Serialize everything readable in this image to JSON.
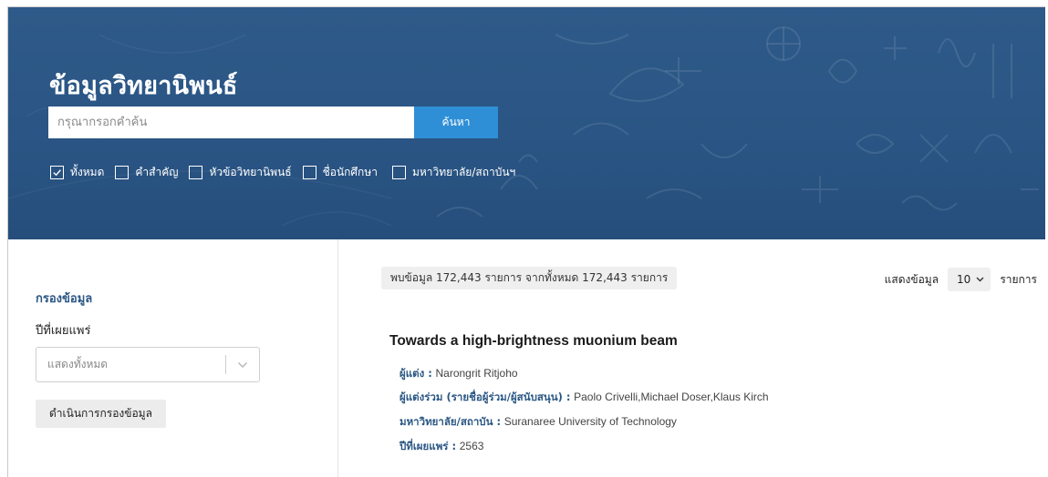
{
  "header": {
    "title": "ข้อมูลวิทยานิพนธ์",
    "search_placeholder": "กรุณากรอกคำค้น",
    "search_button": "ค้นหา",
    "filters": [
      {
        "label": "ทั้งหมด",
        "checked": true
      },
      {
        "label": "คำสำคัญ",
        "checked": false
      },
      {
        "label": "หัวข้อวิทยานิพนธ์",
        "checked": false
      },
      {
        "label": "ชื่อนักศึกษา",
        "checked": false
      },
      {
        "label": "มหาวิทยาลัย/สถาบันฯ",
        "checked": false
      }
    ]
  },
  "sidebar": {
    "title": "กรองข้อมูล",
    "year_label": "ปีที่เผยแพร่",
    "year_select_value": "แสดงทั้งหมด",
    "apply_button": "ดำเนินการกรองข้อมูล"
  },
  "results": {
    "count_text": "พบข้อมูล 172,443 รายการ จากทั้งหมด 172,443 รายการ",
    "show_label": "แสดงข้อมูล",
    "page_size": "10",
    "show_unit": "รายการ",
    "items": [
      {
        "title": "Towards a high-brightness muonium beam",
        "author_label": "ผู้แต่ง :",
        "author": "Narongrit Ritjoho",
        "coauthor_label": "ผู้แต่งร่วม (รายชื่อผู้ร่วม/ผู้สนับสนุน) :",
        "coauthors": "Paolo Crivelli,Michael Doser,Klaus Kirch",
        "university_label": "มหาวิทยาลัย/สถาบัน :",
        "university": "Suranaree University of Technology",
        "year_label": "ปีที่เผยแพร่ :",
        "year": "2563"
      }
    ]
  },
  "colors": {
    "hero_background": "#2a5584",
    "accent_blue": "#2f8fd6",
    "label_blue": "#2b5784"
  },
  "icons": {
    "checkbox_checked": "check-icon",
    "select_arrow": "chevron-down-icon"
  }
}
